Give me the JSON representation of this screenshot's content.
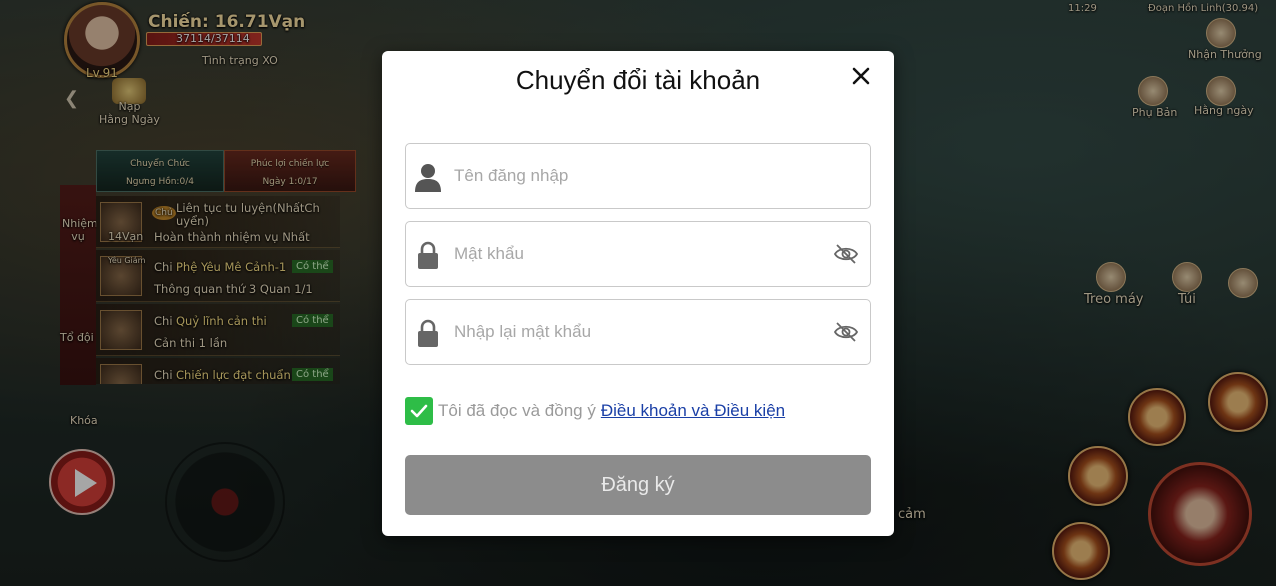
{
  "hud": {
    "power": "Chiến: 16.71Vạn",
    "hp": "37114/37114",
    "status": "Tình trạng XO",
    "level": "Lv.91",
    "nap": "Nạp\nHằng Ngày",
    "tabs": [
      {
        "title": "Chuyển Chức",
        "sub": "Ngưng Hồn:0/4"
      },
      {
        "title": "Phúc lợi chiến lực",
        "sub": "Ngày 1:0/17"
      }
    ],
    "side_labels": [
      "Nhiệm vụ",
      "Tổ đội"
    ],
    "lock_label": "Khóa",
    "quests": [
      {
        "icon_label": "14Vạn",
        "tag": "Chủ",
        "title": "Liên tục tu luyện(NhấtCh uyển)",
        "desc": "Hoàn thành nhiệm vụ Nhất",
        "badge": ""
      },
      {
        "icon_label": "Yêu Giám",
        "tag": "Chi",
        "title": "Phệ Yêu Mê Cảnh-1",
        "desc": "Thông quan thứ 3 Quan 1/1",
        "badge": "Có thể"
      },
      {
        "icon_label": "",
        "tag": "Chi",
        "title": "Quỷ lĩnh cản thi",
        "desc": "Cản thi 1 lần",
        "badge": "Có thể"
      },
      {
        "icon_label": "",
        "tag": "Chi",
        "title": "Chiến lực đạt chuẩn",
        "desc": "",
        "badge": "Có thể"
      }
    ],
    "top_status": "11:29",
    "player_name": "Đoạn Hồn Linh(30.94)",
    "right_labels": {
      "nhan_thuong": "Nhận Thưởng",
      "phu_ban": "Phụ Bản",
      "hang_ngay": "Hằng ngày",
      "treo_may": "Treo máy",
      "tui": "Túi",
      "emote": "cảm"
    }
  },
  "modal": {
    "title": "Chuyển đổi tài khoản",
    "username_placeholder": "Tên đăng nhập",
    "password_placeholder": "Mật khẩu",
    "confirm_placeholder": "Nhập lại mật khẩu",
    "agree_text": "Tôi đã đọc và đồng ý",
    "terms_link": "Điều khoản và Điều kiện",
    "submit_label": "Đăng ký",
    "agree_checked": true,
    "colors": {
      "checkbox": "#2ebd47",
      "link": "#1a3fa6",
      "submit_bg": "#8c8c8c"
    },
    "icons": [
      "user-icon",
      "lock-icon",
      "eye-off-icon",
      "close-icon",
      "check-icon"
    ]
  }
}
